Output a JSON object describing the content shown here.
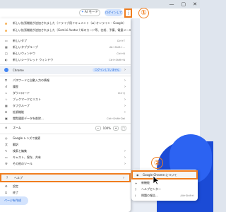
{
  "toolbar": {
    "ai_mode_label": "AI モード",
    "profile_label": "ログインしてい",
    "kebab": "⋮"
  },
  "window_controls": {
    "minimize": "—",
    "maximize": "▢",
    "close": "✕"
  },
  "callouts": {
    "first": "①",
    "second": "②"
  },
  "notices": [
    "新しい拡張機能が追加されました（ドライブ用ドキュメント（ω) オンライン・Google）",
    "新しい拡張機能が追加されました（Gemini Avatar / 知のカード等、名前、予備、電量メール）"
  ],
  "menu": {
    "new_tab": {
      "label": "新しいタブ",
      "shortcut": "Ctrl+T"
    },
    "new_tab_group": {
      "label": "新しいタブグループ",
      "shortcut": "Alt+Shift+…"
    },
    "new_window": {
      "label": "新しいウィンドウ",
      "shortcut": "Ctrl+N"
    },
    "new_incognito": {
      "label": "新しいシークレット ウィンドウ",
      "shortcut": "Ctrl+Shift+N"
    },
    "profile": {
      "label": "Chrome",
      "pill": "ログインしていません"
    },
    "passwords": {
      "label": "パスワードと自動入力の情報"
    },
    "history": {
      "label": "履歴"
    },
    "downloads": {
      "label": "ダウンロード",
      "shortcut": "Ctrl+J"
    },
    "bookmarks": {
      "label": "ブックマークとリスト"
    },
    "tab_groups": {
      "label": "タブグループ"
    },
    "extensions": {
      "label": "拡張機能"
    },
    "clear_data": {
      "label": "閲覧履歴データを削除…",
      "shortcut": "Ctrl+Shift+Del"
    },
    "zoom": {
      "label": "ズーム",
      "value": "100%",
      "minus": "−",
      "plus": "+"
    },
    "google_lens": {
      "label": "Google レンズで検索"
    },
    "translate": {
      "label": "翻訳"
    },
    "find_edit": {
      "label": "検索と編集"
    },
    "cast_save": {
      "label": "キャスト、保存、共有"
    },
    "more_tools": {
      "label": "その他のツール"
    },
    "help": {
      "label": "ヘルプ"
    },
    "settings": {
      "label": "設定"
    },
    "exit": {
      "label": "終了"
    }
  },
  "submenu": {
    "about": {
      "label": "Google Chrome について"
    },
    "whats_new": {
      "label": "新機能"
    },
    "help_center": {
      "label": "ヘルプセンター"
    },
    "report_issue": {
      "label": "問題の報告…",
      "shortcut": "Alt+Shift+I"
    }
  },
  "bottom_button": {
    "label": "ページを作成"
  },
  "colors": {
    "accent_orange": "#f07d1e",
    "chrome_blue": "#0b57d0",
    "pill_blue": "#d3e3fd",
    "wallpaper_blue": "#1b4bd6"
  }
}
